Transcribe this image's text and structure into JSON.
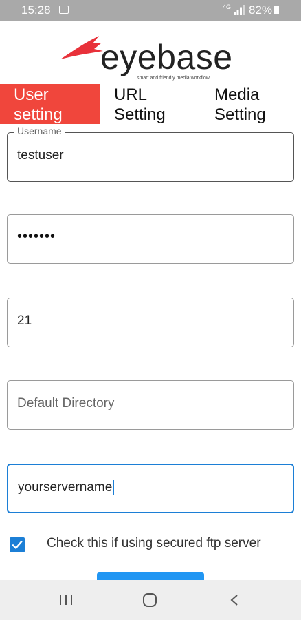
{
  "status_bar": {
    "time": "15:28",
    "network": "4G",
    "battery_percent": "82%"
  },
  "logo": {
    "name": "eyebase",
    "tagline": "smart and friendly media workflow",
    "accent_color": "#e8313a"
  },
  "tabs": [
    {
      "label_line1": "User",
      "label_line2": "setting",
      "active": true
    },
    {
      "label_line1": "URL",
      "label_line2": "Setting",
      "active": false
    },
    {
      "label_line1": "Media",
      "label_line2": "Setting",
      "active": false
    }
  ],
  "form": {
    "username": {
      "label": "Username",
      "value": "testuser"
    },
    "password": {
      "value": "•••••••"
    },
    "port": {
      "value": "21"
    },
    "directory": {
      "placeholder": "Default Directory",
      "value": ""
    },
    "server": {
      "value": "yourservername",
      "focused": true
    }
  },
  "secure_checkbox": {
    "label": "Check this if using secured ftp server",
    "checked": true
  },
  "colors": {
    "active_tab": "#f0463c",
    "primary": "#1c7fd6",
    "button": "#2196f3"
  },
  "nav_bar": {
    "recents_icon": "recents-icon",
    "home_icon": "home-icon",
    "back_icon": "back-icon"
  }
}
